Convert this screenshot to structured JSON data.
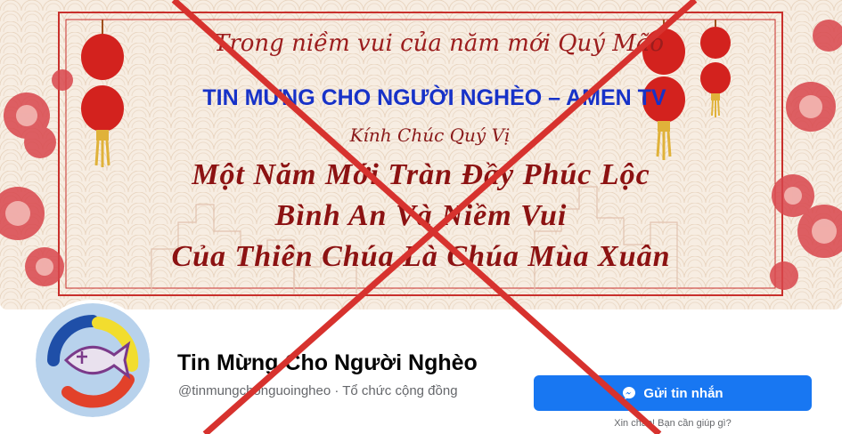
{
  "cover": {
    "line1": "Trong niềm vui của năm mới Quý Mão",
    "line2": "TIN MỪNG CHO NGƯỜI NGHÈO – AMEN TV",
    "line3": "Kính Chúc Quý Vị",
    "blessing_1": "Một Năm Mới Tràn Đầy Phúc Lộc",
    "blessing_2": "Bình An Và Niềm Vui",
    "blessing_3": "Của Thiên Chúa Là Chúa Mùa Xuân"
  },
  "page": {
    "name": "Tin Mừng Cho Người Nghèo",
    "meta": "@tinmungchonguoingheo · Tổ chức cộng đồng"
  },
  "actions": {
    "message_label": "Gửi tin nhắn",
    "help_text": "Xin chào! Bạn cần giúp gì?"
  },
  "icons": {
    "message": "messenger-icon",
    "avatar": "fish-logo-icon"
  },
  "colors": {
    "primary_button": "#1877f2",
    "cross": "#d7322e",
    "cover_text": "#8c1212",
    "cover_blue_text": "#1732c8"
  }
}
